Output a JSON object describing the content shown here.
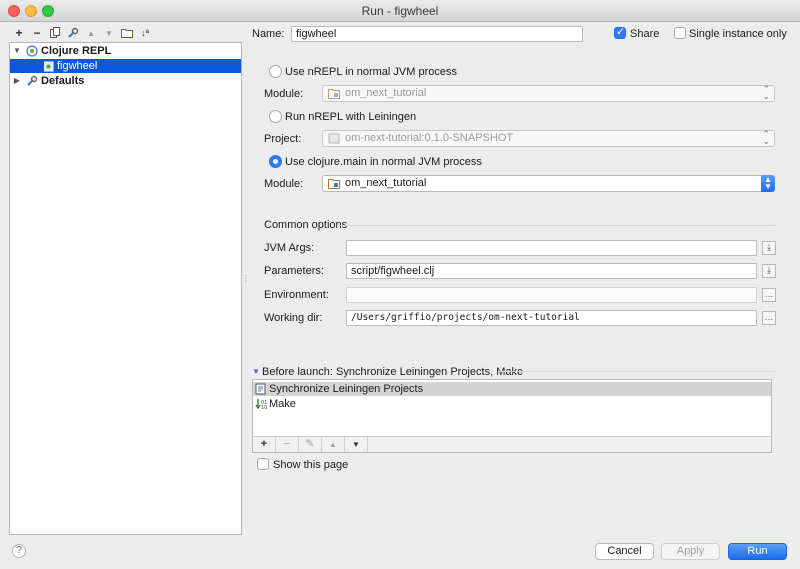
{
  "window": {
    "title": "Run - figwheel"
  },
  "left_toolbar": {
    "buttons": [
      {
        "icon": "plus",
        "glyph": "+"
      },
      {
        "icon": "minus",
        "glyph": "−"
      },
      {
        "icon": "copy",
        "glyph": "⧉"
      },
      {
        "icon": "wrench",
        "glyph": "⚒"
      },
      {
        "icon": "move-up",
        "glyph": "▲"
      },
      {
        "icon": "move-down",
        "glyph": "▼"
      },
      {
        "icon": "folder",
        "glyph": "▭"
      },
      {
        "icon": "sort",
        "glyph": "⇅"
      }
    ]
  },
  "tree": {
    "items": [
      {
        "label": "Clojure REPL",
        "expanded": true,
        "level": 0,
        "icon": "clojure-repl-icon"
      },
      {
        "label": "figwheel",
        "level": 1,
        "selected": true,
        "icon": "run-config-icon"
      },
      {
        "label": "Defaults",
        "expanded": false,
        "level": 0,
        "icon": "defaults-icon"
      }
    ]
  },
  "form": {
    "name_label": "Name:",
    "name_value": "figwheel",
    "share_label": "Share",
    "share_checked": true,
    "single_instance_label": "Single instance only",
    "single_instance_checked": false,
    "radio_nrepl_jvm": "Use nREPL in normal JVM process",
    "module_label": "Module:",
    "module_1_value": "om_next_tutorial",
    "radio_nrepl_lein": "Run nREPL with Leiningen",
    "project_label": "Project:",
    "project_value": "om-next-tutorial:0.1.0-SNAPSHOT",
    "radio_clojure_main": "Use clojure.main in normal JVM process",
    "module_2_value": "om_next_tutorial",
    "selected_radio": "clojure_main"
  },
  "common_options": {
    "title": "Common options",
    "jvm_args_label": "JVM Args:",
    "jvm_args_value": "",
    "parameters_label": "Parameters:",
    "parameters_value": "script/figwheel.clj",
    "environment_label": "Environment:",
    "environment_value": "",
    "working_dir_label": "Working dir:",
    "working_dir_value": "/Users/griffio/projects/om-next-tutorial"
  },
  "before_launch": {
    "title": "Before launch: Synchronize Leiningen Projects, Make",
    "items": [
      {
        "label": "Synchronize Leiningen Projects",
        "icon": "leiningen-sync-icon"
      },
      {
        "label": "Make",
        "icon": "make-icon"
      }
    ],
    "show_page_label": "Show this page",
    "show_page_checked": false
  },
  "buttons": {
    "help": "?",
    "cancel": "Cancel",
    "apply": "Apply",
    "run": "Run"
  },
  "colors": {
    "accent": "#2f7df6",
    "selection": "#0f57d9"
  }
}
